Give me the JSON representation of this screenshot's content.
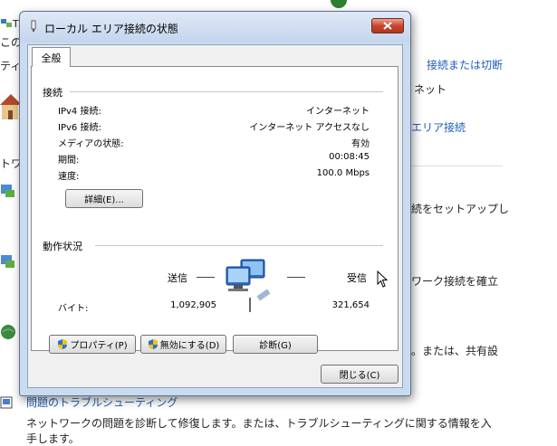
{
  "background": {
    "partial_left": [
      "Ti",
      "この",
      "ティ",
      "ネット",
      "トワ"
    ],
    "link_connect_disconnect": "接続または切断",
    "net_text": "ネット",
    "link_area_connection": "エリア接続",
    "setup_text": "続をセットアップし",
    "work_text": "ワーク接続を確立",
    "share_text": "。または、共有設",
    "trouble_link": "問題のトラブルシューティング",
    "trouble_desc_1": "ネットワークの問題を診断して修復します。または、トラブルシューティングに関する情報を入",
    "trouble_desc_2": "手します。"
  },
  "dialog": {
    "title": "ローカル エリア接続の状態",
    "tab_general": "全般",
    "connection_section": "接続",
    "rows": [
      {
        "label": "IPv4 接続:",
        "value": "インターネット"
      },
      {
        "label": "IPv6 接続:",
        "value": "インターネット アクセスなし"
      },
      {
        "label": "メディアの状態:",
        "value": "有効"
      },
      {
        "label": "期間:",
        "value": "00:08:45"
      },
      {
        "label": "速度:",
        "value": "100.0 Mbps"
      }
    ],
    "details_button": "詳細(E)...",
    "activity_section": "動作状況",
    "sent_label": "送信",
    "received_label": "受信",
    "bytes_label": "バイト:",
    "bytes_sent": "1,092,905",
    "bytes_received": "321,654",
    "properties_button": "プロパティ(P)",
    "disable_button": "無効にする(D)",
    "diagnose_button": "診断(G)",
    "close_button": "閉じる(C)"
  },
  "colors": {
    "link": "#1f5fb6",
    "close_button": "#c8452f",
    "window_frame": "#c9dbef"
  },
  "icons": [
    "network-adapter-icon",
    "close-icon",
    "uac-shield-icon",
    "computer-network-icon",
    "house-icon",
    "mouse-cursor-icon"
  ]
}
